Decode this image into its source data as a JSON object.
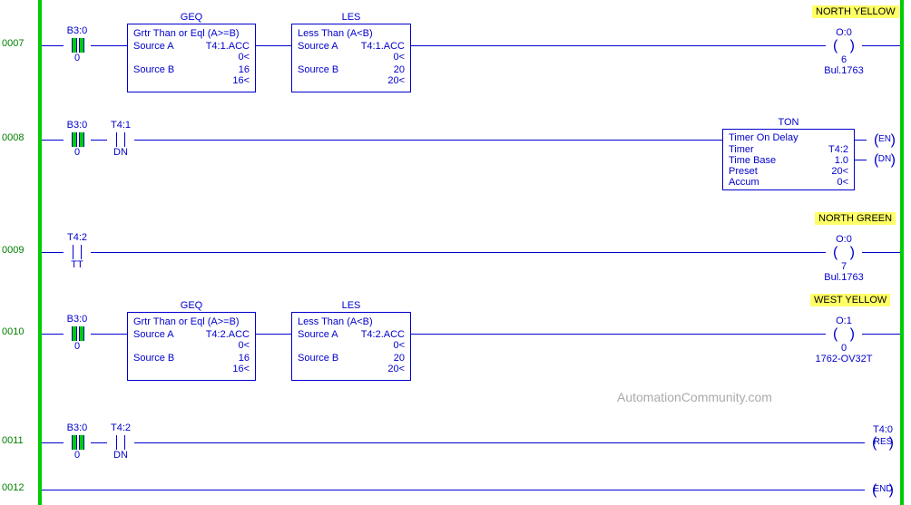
{
  "watermark": "AutomationCommunity.com",
  "rungs": {
    "r7": {
      "num": "0007",
      "xic1_top": "B3:0",
      "xic1_bot": "0",
      "geq_title": "GEQ",
      "geq_desc": "Grtr Than or Eql (A>=B)",
      "geq_sa_lbl": "Source A",
      "geq_sa_val": "T4:1.ACC",
      "geq_sa_sub": "0<",
      "geq_sb_lbl": "Source B",
      "geq_sb_val": "16",
      "geq_sb_sub": "16<",
      "les_title": "LES",
      "les_desc": "Less Than (A<B)",
      "les_sa_lbl": "Source A",
      "les_sa_val": "T4:1.ACC",
      "les_sa_sub": "0<",
      "les_sb_lbl": "Source B",
      "les_sb_val": "20",
      "les_sb_sub": "20<",
      "out_hl": "NORTH YELLOW",
      "out_top": "O:0",
      "out_bot": "6",
      "out_bot2": "Bul.1763"
    },
    "r8": {
      "num": "0008",
      "xic1_top": "B3:0",
      "xic1_bot": "0",
      "xic2_top": "T4:1",
      "xic2_bot": "DN",
      "ton_title": "TON",
      "ton_desc": "Timer On Delay",
      "ton_timer_lbl": "Timer",
      "ton_timer_val": "T4:2",
      "ton_tb_lbl": "Time Base",
      "ton_tb_val": "1.0",
      "ton_pre_lbl": "Preset",
      "ton_pre_val": "20<",
      "ton_acc_lbl": "Accum",
      "ton_acc_val": "0<",
      "en": "EN",
      "dn": "DN"
    },
    "r9": {
      "num": "0009",
      "xic1_top": "T4:2",
      "xic1_bot": "TT",
      "out_hl": "NORTH GREEN",
      "out_top": "O:0",
      "out_bot": "7",
      "out_bot2": "Bul.1763"
    },
    "r10": {
      "num": "0010",
      "xic1_top": "B3:0",
      "xic1_bot": "0",
      "geq_title": "GEQ",
      "geq_desc": "Grtr Than or Eql (A>=B)",
      "geq_sa_lbl": "Source A",
      "geq_sa_val": "T4:2.ACC",
      "geq_sa_sub": "0<",
      "geq_sb_lbl": "Source B",
      "geq_sb_val": "16",
      "geq_sb_sub": "16<",
      "les_title": "LES",
      "les_desc": "Less Than (A<B)",
      "les_sa_lbl": "Source A",
      "les_sa_val": "T4:2.ACC",
      "les_sa_sub": "0<",
      "les_sb_lbl": "Source B",
      "les_sb_val": "20",
      "les_sb_sub": "20<",
      "out_hl": "WEST YELLOW",
      "out_top": "O:1",
      "out_bot": "0",
      "out_bot2": "1762-OV32T"
    },
    "r11": {
      "num": "0011",
      "xic1_top": "B3:0",
      "xic1_bot": "0",
      "xic2_top": "T4:2",
      "xic2_bot": "DN",
      "res_top": "T4:0",
      "res_mid": "RES"
    },
    "r12": {
      "num": "0012",
      "end": "END"
    }
  }
}
